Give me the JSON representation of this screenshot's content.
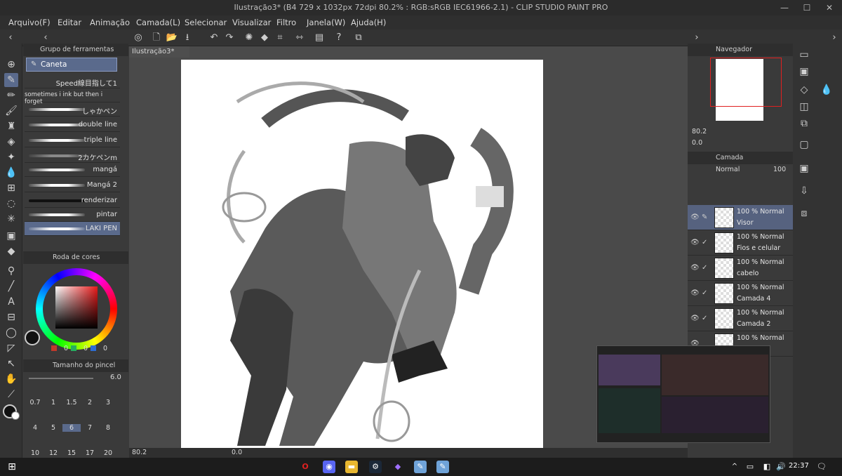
{
  "title_bar": {
    "title": "Ilustração3* (B4 729 x 1032px 72dpi 80.2% : RGB:sRGB IEC61966-2.1) - CLIP STUDIO PAINT PRO",
    "minimize": "—",
    "maximize": "☐",
    "close": "✕"
  },
  "menu": [
    "Arquivo(F)",
    "Editar",
    "Animação",
    "Camada(L)",
    "Selecionar",
    "Visualizar",
    "Filtro",
    "Janela(W)",
    "Ajuda(H)"
  ],
  "tool_group_panel": {
    "title": "Grupo de ferramentas",
    "active_tool": "Caneta"
  },
  "brushes": [
    {
      "label": "Speed線目指して1"
    },
    {
      "label": "sometimes i ink but then i forget"
    },
    {
      "label": "しゃかペン"
    },
    {
      "label": "double line"
    },
    {
      "label": "triple line"
    },
    {
      "label": "2カケペンm"
    },
    {
      "label": "mangá"
    },
    {
      "label": "Mangá 2"
    },
    {
      "label": "renderizar"
    },
    {
      "label": "pintar"
    },
    {
      "label": "LAKI PEN"
    }
  ],
  "color_wheel_panel": {
    "title": "Roda de cores",
    "r": "0",
    "g": "0",
    "b": "0",
    "main_color": "#1a1a1a",
    "sub_color": "#ffffff"
  },
  "brush_size_panel": {
    "title": "Tamanho do pincel",
    "value": "6.0",
    "sizes": [
      "0.7",
      "1",
      "1.5",
      "2",
      "3",
      "4",
      "5",
      "6",
      "7",
      "8",
      "10",
      "12",
      "15",
      "17",
      "20"
    ]
  },
  "canvas": {
    "tab_label": "Ilustração3*",
    "zoom": "80.2",
    "angle": "0.0"
  },
  "navigator": {
    "title": "Navegador",
    "zoom": "80.2",
    "angle": "0.0"
  },
  "layer_panel": {
    "title": "Camada",
    "blend_mode": "Normal",
    "opacity": "100",
    "layers": [
      {
        "opacity": "100 % Normal",
        "name": "Visor"
      },
      {
        "opacity": "100 % Normal",
        "name": "Fios e celular"
      },
      {
        "opacity": "100 % Normal",
        "name": "cabelo"
      },
      {
        "opacity": "100 % Normal",
        "name": "Camada 4"
      },
      {
        "opacity": "100 % Normal",
        "name": "Camada 2"
      },
      {
        "opacity": "100 % Normal",
        "name": ""
      }
    ]
  },
  "taskbar": {
    "time": "22:37"
  },
  "colors": {
    "accent": "#5a6a8c",
    "panel": "#3a3a3a",
    "canvas_bg": "#4a4a4a"
  }
}
